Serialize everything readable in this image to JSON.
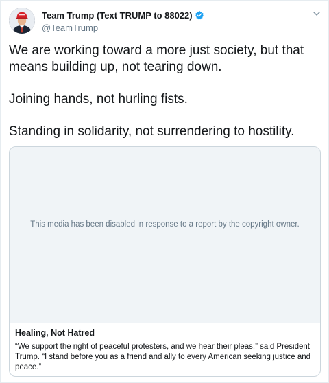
{
  "author": {
    "display_name": "Team Trump (Text TRUMP to 88022)",
    "handle": "@TeamTrump",
    "verified": true,
    "avatar_icon": "profile-photo-red-cap"
  },
  "tweet": {
    "paragraphs": [
      "We are working toward a more just society, but that means building up, not tearing down.",
      "Joining hands, not hurling fists.",
      "Standing in solidarity, not surrendering to hostility."
    ]
  },
  "card": {
    "media_notice": "This media has been disabled in response to a report by the copyright owner.",
    "title": "Healing, Not Hatred",
    "description": "“We support the right of peaceful protesters, and we hear their pleas,” said President Trump.   “I stand before you as a friend and ally to every American seeking justice and peace.”"
  },
  "icons": {
    "verified": "verified-badge-icon",
    "caret": "chevron-down-icon"
  },
  "colors": {
    "verified_blue": "#1da1f2",
    "text_primary": "#14171a",
    "text_secondary": "#657786",
    "media_bg": "#f0f4f7",
    "card_border": "#ccd6dd"
  }
}
